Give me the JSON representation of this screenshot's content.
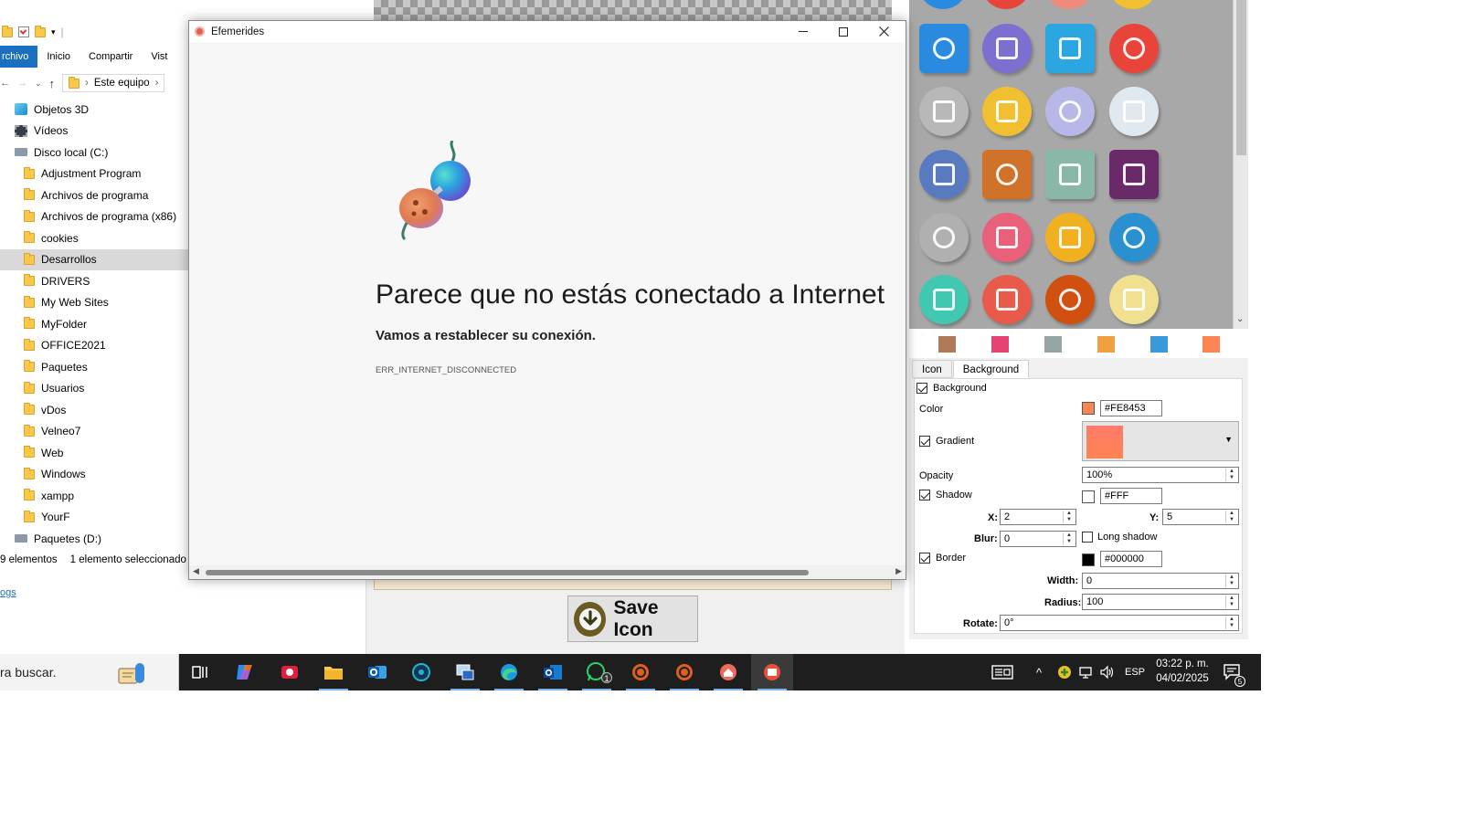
{
  "explorer": {
    "ribbon_tabs": [
      "rchivo",
      "Inicio",
      "Compartir",
      "Vist"
    ],
    "address": "Este equipo",
    "tree": [
      {
        "label": "Objetos 3D",
        "level": 0,
        "icon": "cube-icon"
      },
      {
        "label": "Vídeos",
        "level": 0,
        "icon": "film-icon"
      },
      {
        "label": "Disco local (C:)",
        "level": 0,
        "icon": "drive-icon"
      },
      {
        "label": "Adjustment Program",
        "level": 1,
        "icon": "folder-icon"
      },
      {
        "label": "Archivos de programa",
        "level": 1,
        "icon": "folder-icon"
      },
      {
        "label": "Archivos de programa (x86)",
        "level": 1,
        "icon": "folder-icon"
      },
      {
        "label": "cookies",
        "level": 1,
        "icon": "folder-icon"
      },
      {
        "label": "Desarrollos",
        "level": 1,
        "icon": "folder-icon",
        "selected": true
      },
      {
        "label": "DRIVERS",
        "level": 1,
        "icon": "folder-icon"
      },
      {
        "label": "My Web Sites",
        "level": 1,
        "icon": "folder-icon"
      },
      {
        "label": "MyFolder",
        "level": 1,
        "icon": "folder-icon"
      },
      {
        "label": "OFFICE2021",
        "level": 1,
        "icon": "folder-icon"
      },
      {
        "label": "Paquetes",
        "level": 1,
        "icon": "folder-icon"
      },
      {
        "label": "Usuarios",
        "level": 1,
        "icon": "folder-icon"
      },
      {
        "label": "vDos",
        "level": 1,
        "icon": "folder-icon"
      },
      {
        "label": "Velneo7",
        "level": 1,
        "icon": "folder-icon"
      },
      {
        "label": "Web",
        "level": 1,
        "icon": "folder-icon"
      },
      {
        "label": "Windows",
        "level": 1,
        "icon": "folder-icon"
      },
      {
        "label": "xampp",
        "level": 1,
        "icon": "folder-icon"
      },
      {
        "label": "YourF",
        "level": 1,
        "icon": "folder-icon"
      },
      {
        "label": "Paquetes (D:)",
        "level": 0,
        "icon": "drive-icon"
      }
    ],
    "status_count": "9 elementos",
    "status_selected": "1 elemento seleccionado",
    "link_text": "ogs"
  },
  "window": {
    "title": "Efemerides",
    "heading": "Parece que no estás conectado a Internet",
    "subheading": "Vamos a restablecer su conexión.",
    "error_code": "ERR_INTERNET_DISCONNECTED"
  },
  "editor": {
    "save_label": "Save Icon",
    "tabs": [
      "Icon",
      "Background"
    ],
    "active_tab": "Background",
    "background_label": "Background",
    "color_label": "Color",
    "color_value": "#FE8453",
    "gradient_label": "Gradient",
    "opacity_label": "Opacity",
    "opacity_value": "100%",
    "shadow_label": "Shadow",
    "shadow_color": "#FFF",
    "x_label": "X:",
    "x_value": "2",
    "y_label": "Y:",
    "y_value": "5",
    "blur_label": "Blur:",
    "blur_value": "0",
    "long_shadow_label": "Long shadow",
    "border_label": "Border",
    "border_color": "#000000",
    "width_label": "Width:",
    "width_value": "0",
    "radius_label": "Radius:",
    "radius_value": "100",
    "rotate_label": "Rotate:",
    "rotate_value": "0°",
    "swatches": [
      "#b07a5a",
      "#e8436f",
      "#95a5a6",
      "#f0a040",
      "#3a9ad9",
      "#fe8453"
    ]
  },
  "gallery": {
    "icons": [
      {
        "name": "cloud-icon",
        "bg": "#2a8ae0"
      },
      {
        "name": "microphone-icon",
        "bg": "#7b6fd0"
      },
      {
        "name": "contacts-book-icon",
        "bg": "#2ba6e0"
      },
      {
        "name": "flashlight-icon",
        "bg": "#e8443a"
      },
      {
        "name": "camera-gray-icon",
        "bg": "#b8b8b8"
      },
      {
        "name": "leaf-icon",
        "bg": "#f0c030"
      },
      {
        "name": "lightbulb-icon",
        "bg": "#b8b8e8"
      },
      {
        "name": "camera-icon",
        "bg": "#e0e8f0"
      },
      {
        "name": "monitor-icon",
        "bg": "#5a7ac0"
      },
      {
        "name": "pie-chart-icon",
        "bg": "#d0722a"
      },
      {
        "name": "airplane-icon",
        "bg": "#8ab8a8"
      },
      {
        "name": "html5-icon",
        "bg": "#6a2a6a"
      },
      {
        "name": "newspaper-icon",
        "bg": "#b0b0b0"
      },
      {
        "name": "search-icon",
        "bg": "#e8607a"
      },
      {
        "name": "clock-icon",
        "bg": "#f0b020"
      },
      {
        "name": "cloud-upload-icon",
        "bg": "#2a90d0"
      },
      {
        "name": "bell-icon",
        "bg": "#40c8b0"
      },
      {
        "name": "pencil-icon",
        "bg": "#e85a4a"
      },
      {
        "name": "heart-icon",
        "bg": "#d05010"
      },
      {
        "name": "bug-icon",
        "bg": "#f0e090"
      }
    ]
  },
  "taskbar": {
    "search_text": "ra buscar.",
    "language": "ESP",
    "time": "03:22 p. m.",
    "date": "04/02/2025",
    "notifications": "5",
    "whatsapp_badge": "1"
  }
}
